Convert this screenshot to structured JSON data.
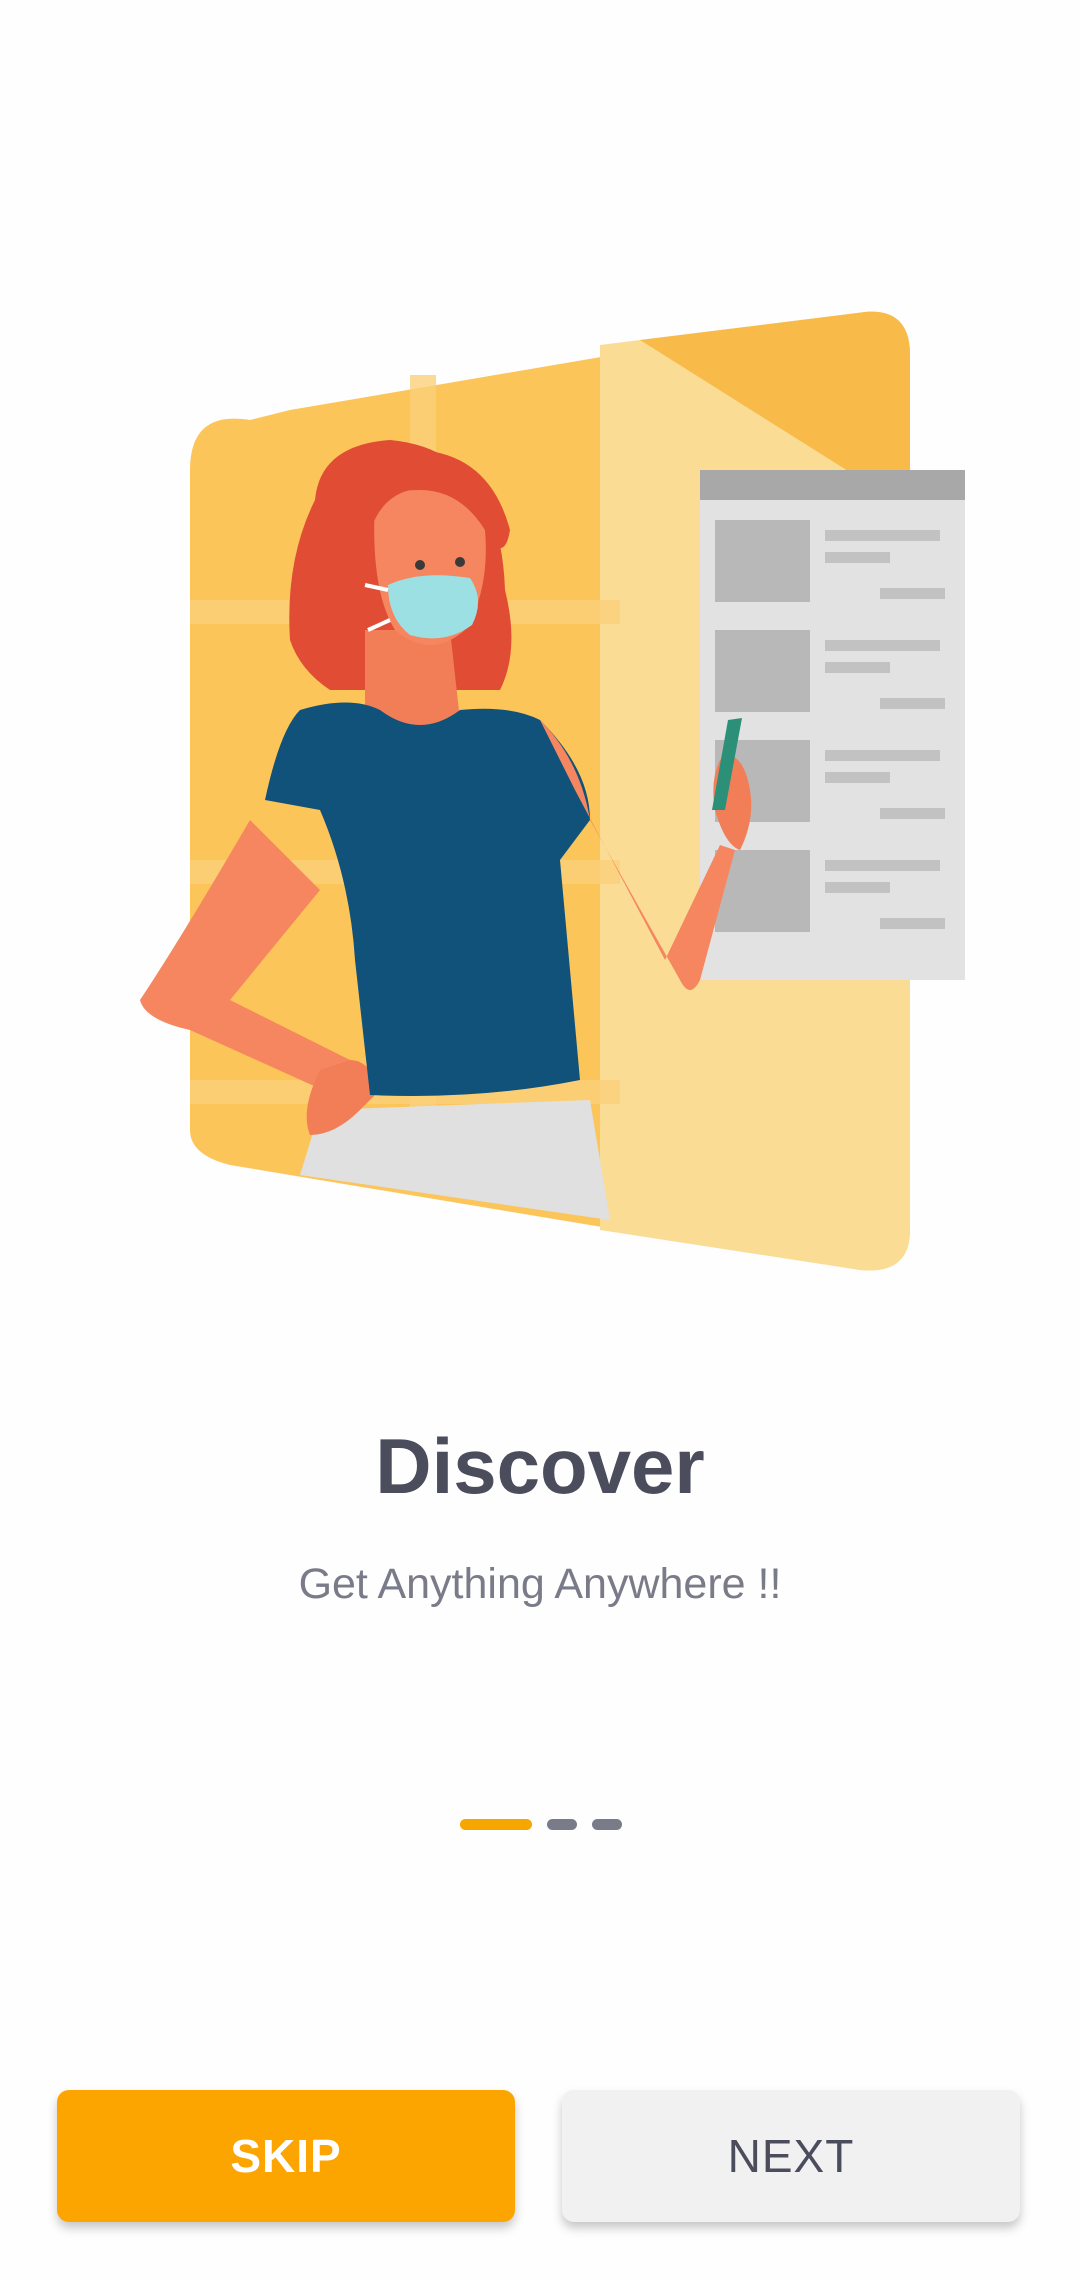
{
  "onboarding": {
    "title": "Discover",
    "subtitle": "Get Anything Anywhere !!",
    "page_indicator": {
      "current": 1,
      "total": 3
    }
  },
  "buttons": {
    "skip_label": "SKIP",
    "next_label": "NEXT"
  },
  "colors": {
    "accent": "#fca400",
    "title_text": "#4b4d5c",
    "subtitle_text": "#7a7b88",
    "secondary_button": "#f1f1f1"
  },
  "illustration": {
    "icon": "woman-with-mask-pointing-at-menu-illustration"
  }
}
